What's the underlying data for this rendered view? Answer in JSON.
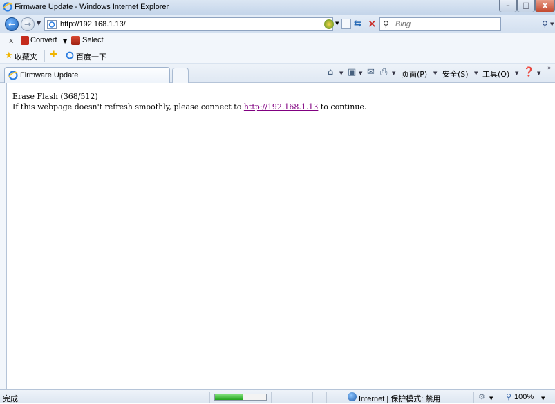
{
  "window": {
    "title": "Firmware Update - Windows Internet Explorer",
    "controls": {
      "minimize": "–",
      "maximize": "□",
      "close": "x"
    }
  },
  "address_bar": {
    "url": "http://192.168.1.13/"
  },
  "search": {
    "placeholder": "Bing"
  },
  "toolbar": {
    "close": "x",
    "convert_label": "Convert",
    "select_label": "Select"
  },
  "favorites": {
    "label": "收藏夹",
    "items": [
      {
        "label": "百度一下"
      }
    ]
  },
  "tabs": [
    {
      "label": "Firmware Update",
      "active": true
    }
  ],
  "command_bar": {
    "page": "页面(P)",
    "safety": "安全(S)",
    "tools": "工具(O)"
  },
  "content": {
    "line1": "Erase Flash (368/512)",
    "line2_before": "If this webpage doesn't refresh smoothly, please connect to ",
    "link_text": "http://192.168.1.13",
    "line2_after": " to continue."
  },
  "status_bar": {
    "status": "完成",
    "progress_fraction": 0.55,
    "zone": "Internet | 保护模式: 禁用",
    "zoom": "100%"
  },
  "colors": {
    "link_visited": "#800080",
    "progress": "#23a41d",
    "close_button": "#c34a30"
  },
  "icons": [
    "ie-icon",
    "back-arrow-icon",
    "forward-arrow-icon",
    "compat-view-icon",
    "refresh-icon",
    "stop-icon",
    "search-icon",
    "star-icon",
    "add-favorite-icon",
    "home-icon",
    "rss-icon",
    "mail-icon",
    "print-icon",
    "help-icon",
    "globe-zone-icon",
    "zoom-icon"
  ]
}
